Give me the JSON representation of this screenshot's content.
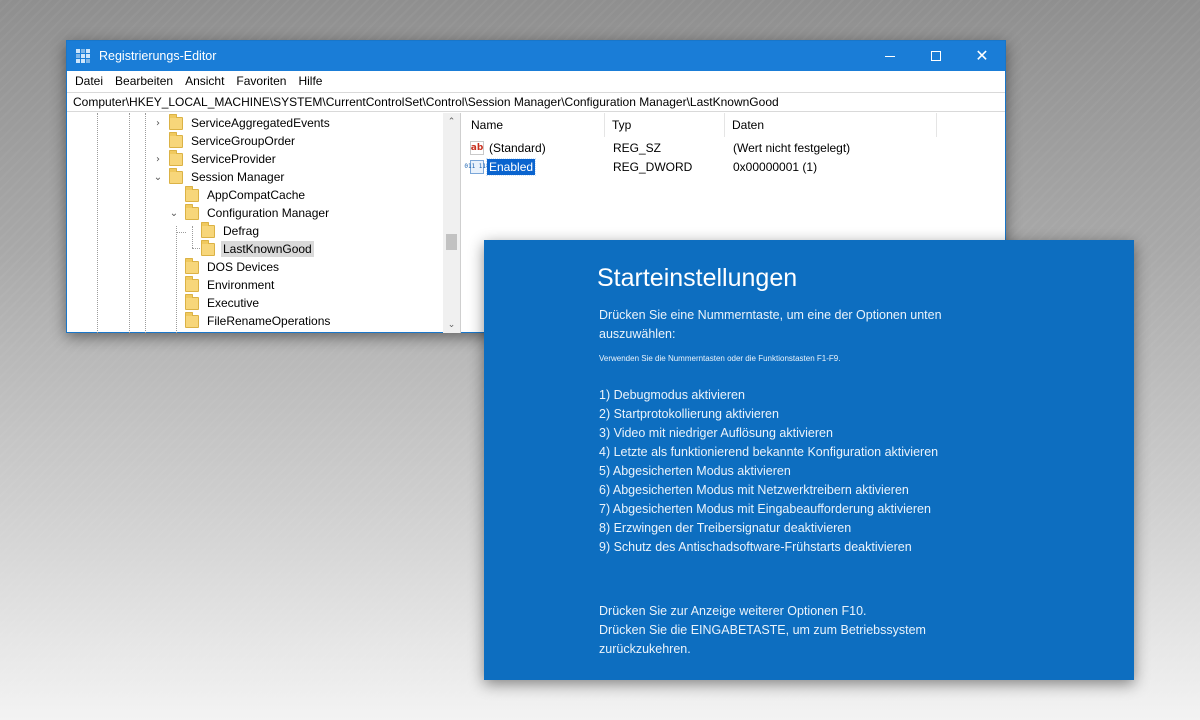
{
  "window": {
    "title": "Registrierungs-Editor",
    "menu": [
      "Datei",
      "Bearbeiten",
      "Ansicht",
      "Favoriten",
      "Hilfe"
    ],
    "address": "Computer\\HKEY_LOCAL_MACHINE\\SYSTEM\\CurrentControlSet\\Control\\Session Manager\\Configuration Manager\\LastKnownGood"
  },
  "tree": {
    "items": [
      {
        "label": "ServiceAggregatedEvents",
        "state": "collapsed"
      },
      {
        "label": "ServiceGroupOrder",
        "state": "leaf"
      },
      {
        "label": "ServiceProvider",
        "state": "collapsed"
      },
      {
        "label": "Session Manager",
        "state": "expanded"
      },
      {
        "label": "AppCompatCache",
        "state": "leaf"
      },
      {
        "label": "Configuration Manager",
        "state": "expanded"
      },
      {
        "label": "Defrag",
        "state": "leaf"
      },
      {
        "label": "LastKnownGood",
        "state": "selected"
      },
      {
        "label": "DOS Devices",
        "state": "leaf"
      },
      {
        "label": "Environment",
        "state": "leaf"
      },
      {
        "label": "Executive",
        "state": "leaf"
      },
      {
        "label": "FileRenameOperations",
        "state": "leaf"
      }
    ]
  },
  "values_list": {
    "columns": [
      "Name",
      "Typ",
      "Daten"
    ],
    "rows": [
      {
        "icon": "string-value-icon",
        "icon_glyph": "ab",
        "name": "(Standard)",
        "type": "REG_SZ",
        "data": "(Wert nicht festgelegt)"
      },
      {
        "icon": "binary-value-icon",
        "icon_glyph": "011 110",
        "name": "Enabled",
        "type": "REG_DWORD",
        "data": "0x00000001 (1)"
      }
    ]
  },
  "start_settings": {
    "title": "Starteinstellungen",
    "intro": "Drücken Sie eine Nummerntaste, um eine der Optionen unten auszuwählen:",
    "hint": "Verwenden Sie die Nummerntasten oder die Funktionstasten F1-F9.",
    "options": [
      "1) Debugmodus aktivieren",
      "2) Startprotokollierung aktivieren",
      "3) Video mit niedriger Auflösung aktivieren",
      "4) Letzte als funktionierend bekannte Konfiguration aktivieren",
      "5) Abgesicherten Modus aktivieren",
      "6) Abgesicherten Modus mit Netzwerktreibern aktivieren",
      "7) Abgesicherten Modus mit Eingabeaufforderung aktivieren",
      "8) Erzwingen der Treibersignatur deaktivieren",
      "9) Schutz des Antischadsoftware-Frühstarts deaktivieren"
    ],
    "footer_line1": "Drücken Sie zur Anzeige weiterer Optionen F10.",
    "footer_line2": "Drücken Sie die EINGABETASTE, um zum Betriebssystem zurückzukehren."
  },
  "colors": {
    "titlebar": "#1a7dd7",
    "start_screen": "#0d6ec0",
    "selection": "#0a64cf"
  }
}
